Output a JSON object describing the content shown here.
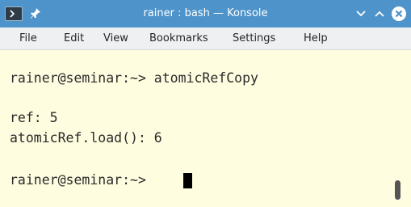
{
  "window": {
    "title": "rainer : bash — Konsole"
  },
  "titlebar": {
    "app_icon": "terminal-icon",
    "pin_icon": "pin-icon",
    "buttons": {
      "minimize": "chevron-down-icon",
      "maximize": "chevron-up-icon",
      "close": "close-icon"
    }
  },
  "menubar": {
    "items": [
      "File",
      "Edit",
      "View",
      "Bookmarks",
      "Settings",
      "Help"
    ]
  },
  "terminal": {
    "lines": [
      "rainer@seminar:~> atomicRefCopy",
      "",
      "ref: 5",
      "atomicRef.load(): 6",
      "",
      "rainer@seminar:~> "
    ]
  },
  "colors": {
    "titlebar": "#4e93c9",
    "menubar": "#eff0f1",
    "terminal_background": "#fffde0",
    "terminal_text": "#2a2a2a",
    "cursor": "#000000"
  }
}
